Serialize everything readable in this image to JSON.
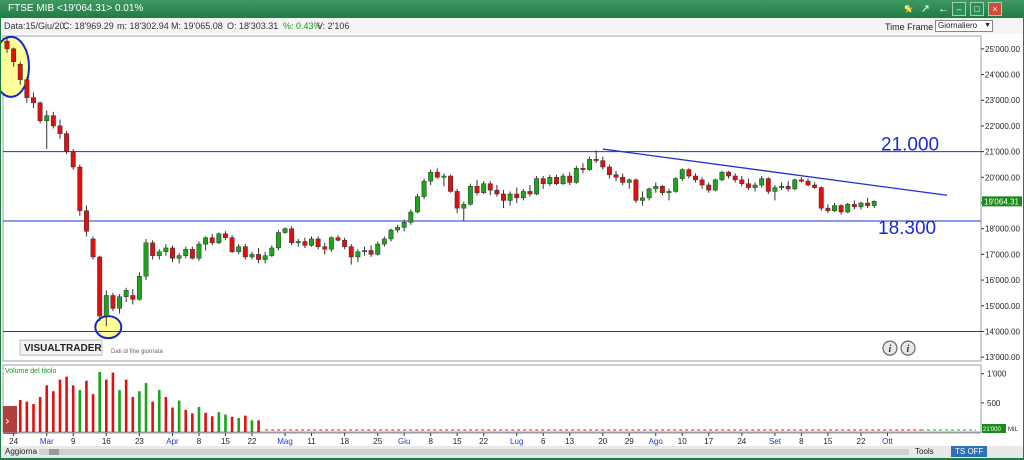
{
  "window": {
    "title": "FTSE MIB <19'064.31> 0.01%",
    "timeframe_label": "Time Frame",
    "timeframe_value": "Giornaliero"
  },
  "info": {
    "data": "Data:15/Giu/20",
    "c": "C: 18'969.29",
    "m": "m: 18'302.94",
    "M": "M: 19'065.08",
    "o": "O: 18'303.31",
    "pct": "%: 0.43%",
    "v": "V: 2'106"
  },
  "bottombar": {
    "update": "Aggiorna",
    "tools": "Tools",
    "tsoff": "TS OFF"
  },
  "colors": {
    "up": "#1aa51a",
    "down": "#e01010",
    "line": "#2030d0",
    "highlight": "#ffff99",
    "circle": "#1428c8",
    "price_tag": "#1a8a1a"
  },
  "chart_data": [
    {
      "type": "candlestick",
      "last_price_label": "19'064.31",
      "logo": "VISUALTRADER",
      "logo_sub": "Dati di fine giornata",
      "info_icon": "i",
      "y_ticks": [
        "25'000.00",
        "24'000.00",
        "23'000.00",
        "22'000.00",
        "21'000.00",
        "20'000.00",
        "19'000.00",
        "18'000.00",
        "17'000.00",
        "16'000.00",
        "15'000.00",
        "14'000.00",
        "13'000.00"
      ],
      "ylim": [
        12850,
        25500
      ],
      "x_ticks": [
        {
          "i": 1,
          "label": "24"
        },
        {
          "i": 6,
          "label": "Mar"
        },
        {
          "i": 10,
          "label": "9"
        },
        {
          "i": 15,
          "label": "16"
        },
        {
          "i": 20,
          "label": "23"
        },
        {
          "i": 25,
          "label": "Apr"
        },
        {
          "i": 29,
          "label": "8"
        },
        {
          "i": 33,
          "label": "15"
        },
        {
          "i": 37,
          "label": "22"
        },
        {
          "i": 42,
          "label": "Mag"
        },
        {
          "i": 46,
          "label": "11"
        },
        {
          "i": 51,
          "label": "18"
        },
        {
          "i": 56,
          "label": "25"
        },
        {
          "i": 60,
          "label": "Giu"
        },
        {
          "i": 64,
          "label": "8"
        },
        {
          "i": 68,
          "label": "15"
        },
        {
          "i": 72,
          "label": "22"
        },
        {
          "i": 77,
          "label": "Lug"
        },
        {
          "i": 81,
          "label": "6"
        },
        {
          "i": 85,
          "label": "13"
        },
        {
          "i": 90,
          "label": "20"
        },
        {
          "i": 94,
          "label": "29"
        },
        {
          "i": 98,
          "label": "Ago"
        },
        {
          "i": 102,
          "label": "10"
        },
        {
          "i": 106,
          "label": "17"
        },
        {
          "i": 111,
          "label": "24"
        },
        {
          "i": 116,
          "label": "Set"
        },
        {
          "i": 120,
          "label": "8"
        },
        {
          "i": 124,
          "label": "15"
        },
        {
          "i": 129,
          "label": "22"
        },
        {
          "i": 133,
          "label": "Ott"
        }
      ],
      "hlines": [
        21000,
        18300,
        14000
      ],
      "annotations": [
        {
          "text": "21.000",
          "price": 21000
        },
        {
          "text": "18.300",
          "price": 18300
        }
      ],
      "trendline": {
        "from": {
          "i": 90,
          "price": 21100
        },
        "to": {
          "i": 142,
          "price": 19300
        }
      },
      "highlight_circles": [
        {
          "i": 0,
          "price": 24300,
          "note": "top"
        },
        {
          "i": 15,
          "price": 14050,
          "note": "bottom"
        }
      ],
      "candles": [
        [
          25300,
          25450,
          24850,
          25000
        ],
        [
          25000,
          25050,
          24300,
          24500
        ],
        [
          24400,
          24500,
          23600,
          23800
        ],
        [
          23800,
          23900,
          22900,
          23100
        ],
        [
          23100,
          23300,
          22700,
          22900
        ],
        [
          22900,
          22950,
          22100,
          22200
        ],
        [
          22200,
          22600,
          21100,
          22400
        ],
        [
          22400,
          22550,
          21900,
          22000
        ],
        [
          22000,
          22250,
          21500,
          21700
        ],
        [
          21700,
          21800,
          20900,
          21000
        ],
        [
          21000,
          21100,
          20300,
          20400
        ],
        [
          20400,
          20500,
          18500,
          18700
        ],
        [
          18700,
          18900,
          17700,
          17900
        ],
        [
          17600,
          17700,
          16800,
          16900
        ],
        [
          16900,
          16950,
          14400,
          14600
        ],
        [
          14600,
          15600,
          14200,
          15400
        ],
        [
          15400,
          15500,
          14800,
          14900
        ],
        [
          14900,
          15450,
          14700,
          15350
        ],
        [
          15350,
          15700,
          15150,
          15600
        ],
        [
          15400,
          15650,
          15050,
          15250
        ],
        [
          15250,
          16300,
          15200,
          16150
        ],
        [
          16150,
          17600,
          16000,
          17450
        ],
        [
          17450,
          17550,
          16800,
          16950
        ],
        [
          16950,
          17200,
          16800,
          17100
        ],
        [
          17100,
          17400,
          16950,
          17250
        ],
        [
          17250,
          17350,
          16700,
          16850
        ],
        [
          16850,
          17050,
          16650,
          16950
        ],
        [
          16950,
          17300,
          16850,
          17200
        ],
        [
          17200,
          17300,
          16800,
          16850
        ],
        [
          16850,
          17500,
          16750,
          17400
        ],
        [
          17400,
          17700,
          17150,
          17650
        ],
        [
          17650,
          17800,
          17350,
          17450
        ],
        [
          17450,
          17850,
          17400,
          17800
        ],
        [
          17800,
          17900,
          17550,
          17650
        ],
        [
          17650,
          17750,
          17050,
          17100
        ],
        [
          17100,
          17400,
          17000,
          17300
        ],
        [
          17300,
          17400,
          16800,
          16900
        ],
        [
          16900,
          17100,
          16800,
          17000
        ],
        [
          17000,
          17250,
          16650,
          16800
        ],
        [
          16800,
          17100,
          16650,
          16950
        ],
        [
          16950,
          17350,
          16900,
          17250
        ],
        [
          17250,
          17950,
          17150,
          17850
        ],
        [
          17850,
          18050,
          17800,
          18000
        ],
        [
          18000,
          18100,
          17350,
          17450
        ],
        [
          17450,
          17600,
          17300,
          17500
        ],
        [
          17500,
          17650,
          17250,
          17350
        ],
        [
          17350,
          17700,
          17300,
          17600
        ],
        [
          17600,
          17700,
          17200,
          17300
        ],
        [
          17300,
          17450,
          17000,
          17200
        ],
        [
          17200,
          17700,
          17100,
          17650
        ],
        [
          17650,
          17750,
          17500,
          17550
        ],
        [
          17550,
          17650,
          17200,
          17300
        ],
        [
          17300,
          17400,
          16600,
          16900
        ],
        [
          16900,
          17200,
          16700,
          17100
        ],
        [
          17100,
          17300,
          16950,
          17150
        ],
        [
          17150,
          17350,
          16900,
          17000
        ],
        [
          17000,
          17500,
          16950,
          17400
        ],
        [
          17400,
          17700,
          17300,
          17600
        ],
        [
          17600,
          18000,
          17500,
          17950
        ],
        [
          17950,
          18150,
          17850,
          18050
        ],
        [
          18050,
          18350,
          17900,
          18250
        ],
        [
          18250,
          18750,
          18150,
          18650
        ],
        [
          18650,
          19350,
          18600,
          19250
        ],
        [
          19250,
          19950,
          19150,
          19850
        ],
        [
          19850,
          20300,
          19700,
          20200
        ],
        [
          20200,
          20350,
          19950,
          20000
        ],
        [
          20000,
          20150,
          19650,
          20050
        ],
        [
          20050,
          20100,
          19400,
          19450
        ],
        [
          19450,
          19550,
          18600,
          18800
        ],
        [
          18800,
          19050,
          18300,
          18950
        ],
        [
          18950,
          19750,
          18900,
          19650
        ],
        [
          19650,
          19900,
          19300,
          19400
        ],
        [
          19400,
          19850,
          19350,
          19750
        ],
        [
          19750,
          19850,
          19300,
          19500
        ],
        [
          19500,
          19700,
          19250,
          19350
        ],
        [
          19350,
          19500,
          18800,
          19100
        ],
        [
          19100,
          19450,
          18900,
          19350
        ],
        [
          19350,
          19600,
          19000,
          19200
        ],
        [
          19200,
          19550,
          19100,
          19450
        ],
        [
          19450,
          19700,
          19250,
          19350
        ],
        [
          19350,
          20050,
          19300,
          19950
        ],
        [
          19950,
          20050,
          19550,
          19750
        ],
        [
          19750,
          20100,
          19650,
          20000
        ],
        [
          20000,
          20100,
          19700,
          19750
        ],
        [
          19750,
          20150,
          19700,
          20050
        ],
        [
          20050,
          20200,
          19700,
          19800
        ],
        [
          19800,
          20450,
          19750,
          20350
        ],
        [
          20350,
          20550,
          20150,
          20300
        ],
        [
          20300,
          20800,
          20250,
          20700
        ],
        [
          20700,
          21050,
          20550,
          20650
        ],
        [
          20650,
          20800,
          20300,
          20400
        ],
        [
          20400,
          20500,
          19950,
          20100
        ],
        [
          20100,
          20250,
          19850,
          20000
        ],
        [
          20000,
          20150,
          19700,
          19800
        ],
        [
          19800,
          19950,
          19550,
          19900
        ],
        [
          19900,
          19950,
          19000,
          19100
        ],
        [
          19100,
          19450,
          18900,
          19200
        ],
        [
          19200,
          19600,
          19100,
          19550
        ],
        [
          19550,
          19800,
          19400,
          19650
        ],
        [
          19650,
          19700,
          19300,
          19400
        ],
        [
          19400,
          19550,
          19100,
          19450
        ],
        [
          19450,
          20000,
          19400,
          19950
        ],
        [
          19950,
          20350,
          19850,
          20300
        ],
        [
          20300,
          20350,
          19950,
          20050
        ],
        [
          20050,
          20150,
          19800,
          19900
        ],
        [
          19900,
          20000,
          19550,
          19700
        ],
        [
          19700,
          19800,
          19400,
          19500
        ],
        [
          19500,
          19950,
          19450,
          19900
        ],
        [
          19900,
          20250,
          19850,
          20200
        ],
        [
          20200,
          20250,
          19950,
          20050
        ],
        [
          20050,
          20150,
          19800,
          19900
        ],
        [
          19900,
          20050,
          19650,
          19750
        ],
        [
          19750,
          19950,
          19500,
          19600
        ],
        [
          19600,
          19800,
          19450,
          19700
        ],
        [
          19700,
          20050,
          19600,
          19950
        ],
        [
          19950,
          20000,
          19350,
          19450
        ],
        [
          19450,
          19700,
          19100,
          19600
        ],
        [
          19600,
          19800,
          19500,
          19650
        ],
        [
          19650,
          19850,
          19450,
          19550
        ],
        [
          19550,
          19950,
          19500,
          19900
        ],
        [
          19900,
          20000,
          19800,
          19850
        ],
        [
          19850,
          19950,
          19650,
          19700
        ],
        [
          19700,
          19800,
          19550,
          19600
        ],
        [
          19600,
          19650,
          18700,
          18800
        ],
        [
          18800,
          18950,
          18600,
          18700
        ],
        [
          18700,
          19000,
          18650,
          18900
        ],
        [
          18900,
          18950,
          18550,
          18650
        ],
        [
          18650,
          19000,
          18600,
          18950
        ],
        [
          18950,
          19100,
          18750,
          18850
        ],
        [
          18850,
          19050,
          18750,
          19000
        ],
        [
          19000,
          19200,
          18800,
          18900
        ],
        [
          18900,
          19100,
          18800,
          19064
        ]
      ],
      "volume": {
        "label": "Volume del titolo",
        "y_ticks": [
          "1'000",
          "500"
        ],
        "ylim": [
          0,
          1150
        ],
        "last_value_label": "21'000",
        "last_value_unit": "MIL",
        "bars": [
          [
            150,
            "up"
          ],
          [
            320,
            "up"
          ],
          [
            550,
            "down"
          ],
          [
            520,
            "down"
          ],
          [
            480,
            "down"
          ],
          [
            600,
            "down"
          ],
          [
            800,
            "down"
          ],
          [
            700,
            "down"
          ],
          [
            900,
            "down"
          ],
          [
            950,
            "down"
          ],
          [
            800,
            "down"
          ],
          [
            720,
            "up"
          ],
          [
            880,
            "down"
          ],
          [
            650,
            "down"
          ],
          [
            1030,
            "up"
          ],
          [
            900,
            "down"
          ],
          [
            1020,
            "down"
          ],
          [
            720,
            "up"
          ],
          [
            900,
            "down"
          ],
          [
            600,
            "down"
          ],
          [
            700,
            "up"
          ],
          [
            840,
            "up"
          ],
          [
            520,
            "down"
          ],
          [
            720,
            "up"
          ],
          [
            600,
            "down"
          ],
          [
            420,
            "down"
          ],
          [
            540,
            "up"
          ],
          [
            380,
            "down"
          ],
          [
            320,
            "down"
          ],
          [
            430,
            "up"
          ],
          [
            330,
            "down"
          ],
          [
            270,
            "down"
          ],
          [
            340,
            "up"
          ],
          [
            300,
            "up"
          ],
          [
            260,
            "down"
          ],
          [
            240,
            "up"
          ],
          [
            280,
            "down"
          ],
          [
            200,
            "up"
          ],
          [
            200,
            "down"
          ]
        ]
      }
    }
  ]
}
